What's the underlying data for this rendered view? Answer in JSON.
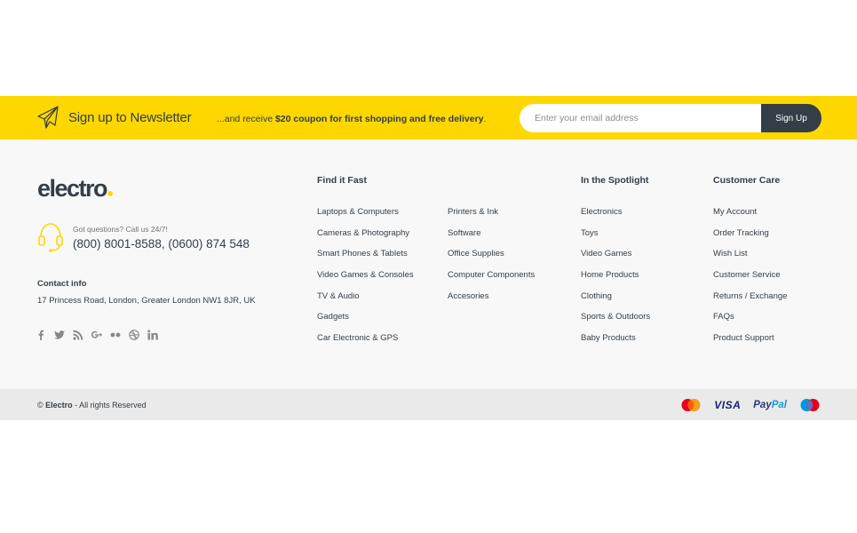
{
  "newsletter": {
    "title": "Sign up to Newsletter",
    "text_prefix": "...and receive ",
    "text_bold": "$20 coupon for first shopping and free delivery",
    "text_suffix": ".",
    "email_placeholder": "Enter your email address",
    "button_label": "Sign Up"
  },
  "brand": {
    "logo_text": "electro",
    "accent_color": "#fed700",
    "dark_color": "#333e48"
  },
  "support": {
    "small_text": "Got questions? Call us 24/7!",
    "phones": "(800) 8001-8588, (0600) 874 548"
  },
  "contact": {
    "title": "Contact info",
    "address": "17 Princess Road, London, Greater London NW1 8JR, UK"
  },
  "socials": [
    "facebook-icon",
    "twitter-icon",
    "rss-icon",
    "google-plus-icon",
    "flickr-icon",
    "dribbble-icon",
    "linkedin-icon"
  ],
  "columns": {
    "find_it_fast": {
      "title": "Find it Fast",
      "links_a": [
        "Laptops & Computers",
        "Cameras & Photography",
        "Smart Phones & Tablets",
        "Video Games & Consoles",
        "TV & Audio",
        "Gadgets",
        "Car Electronic & GPS"
      ],
      "links_b": [
        "Printers & Ink",
        "Software",
        "Office Supplies",
        "Computer Components",
        "Accesories"
      ]
    },
    "spotlight": {
      "title": "In the Spotlight",
      "links": [
        "Electronics",
        "Toys",
        "Video Games",
        "Home Products",
        "Clothing",
        "Sports & Outdoors",
        "Baby Products"
      ]
    },
    "customer_care": {
      "title": "Customer Care",
      "links": [
        "My Account",
        "Order Tracking",
        "Wish List",
        "Customer Service",
        "Returns / Exchange",
        "FAQs",
        "Product Support"
      ]
    }
  },
  "copyright": {
    "prefix": "© ",
    "brand": "Electro",
    "suffix": " - All rights Reserved"
  },
  "payments": {
    "visa": "VISA",
    "paypal_a": "Pay",
    "paypal_b": "Pal"
  }
}
